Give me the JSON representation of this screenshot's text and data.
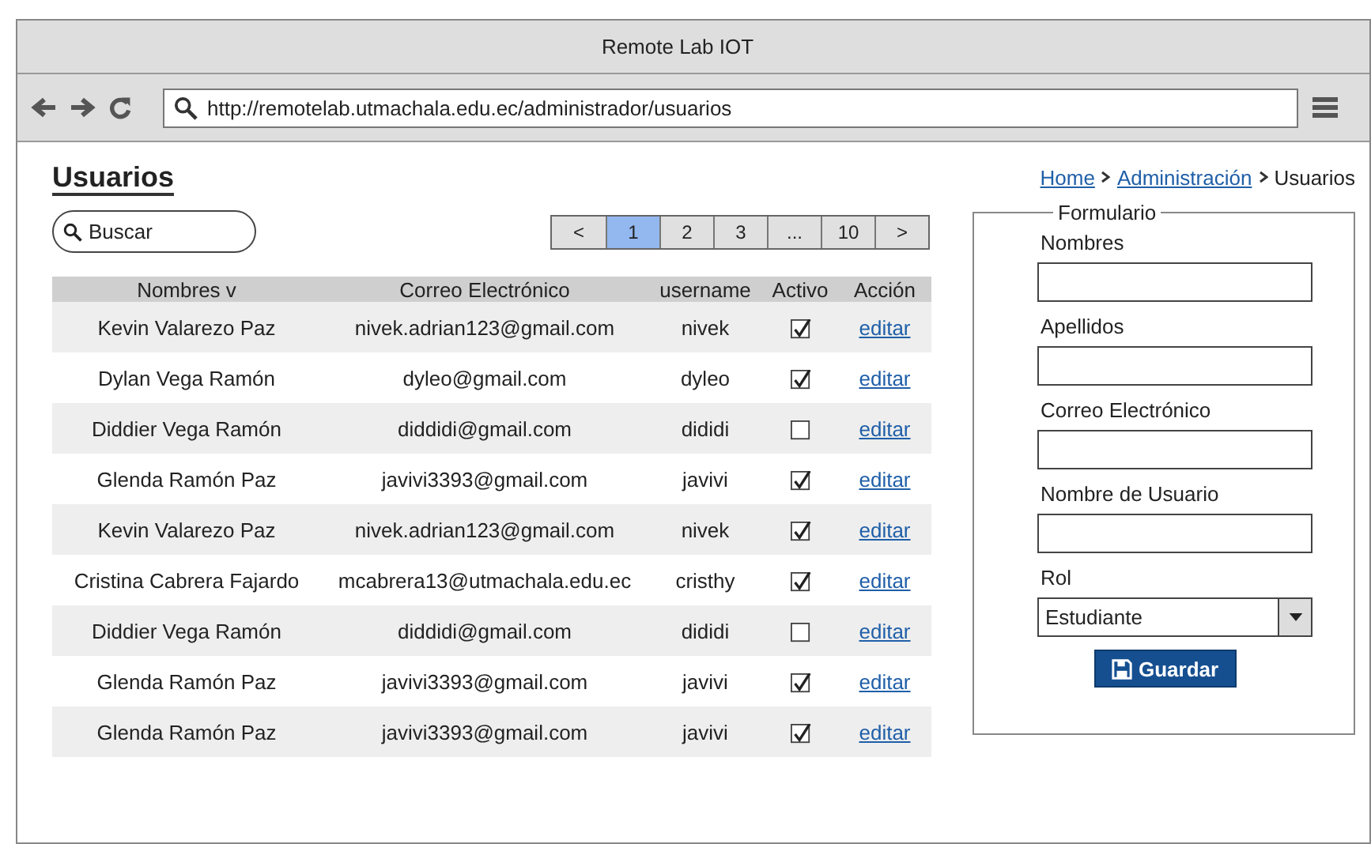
{
  "window": {
    "title": "Remote Lab IOT"
  },
  "browser": {
    "url": "http://remotelab.utmachala.edu.ec/administrador/usuarios"
  },
  "page": {
    "heading": "Usuarios"
  },
  "search": {
    "placeholder": "Buscar"
  },
  "pagination": [
    {
      "label": "<",
      "selected": false
    },
    {
      "label": "1",
      "selected": true
    },
    {
      "label": "2",
      "selected": false
    },
    {
      "label": "3",
      "selected": false
    },
    {
      "label": "...",
      "selected": false
    },
    {
      "label": "10",
      "selected": false
    },
    {
      "label": ">",
      "selected": false
    }
  ],
  "table": {
    "columns": [
      "Nombres v",
      "Correo Electrónico",
      "username",
      "Activo",
      "Acción"
    ],
    "rows": [
      {
        "name": "Kevin Valarezo Paz",
        "email": "nivek.adrian123@gmail.com",
        "username": "nivek",
        "active": true,
        "action": "editar"
      },
      {
        "name": "Dylan Vega Ramón",
        "email": "dyleo@gmail.com",
        "username": "dyleo",
        "active": true,
        "action": "editar"
      },
      {
        "name": "Diddier Vega Ramón",
        "email": "diddidi@gmail.com",
        "username": "dididi",
        "active": false,
        "action": "editar"
      },
      {
        "name": "Glenda Ramón Paz",
        "email": "javivi3393@gmail.com",
        "username": "javivi",
        "active": true,
        "action": "editar"
      },
      {
        "name": "Kevin Valarezo Paz",
        "email": "nivek.adrian123@gmail.com",
        "username": "nivek",
        "active": true,
        "action": "editar"
      },
      {
        "name": "Cristina Cabrera Fajardo",
        "email": "mcabrera13@utmachala.edu.ec",
        "username": "cristhy",
        "active": true,
        "action": "editar"
      },
      {
        "name": "Diddier Vega Ramón",
        "email": "diddidi@gmail.com",
        "username": "dididi",
        "active": false,
        "action": "editar"
      },
      {
        "name": "Glenda Ramón Paz",
        "email": "javivi3393@gmail.com",
        "username": "javivi",
        "active": true,
        "action": "editar"
      },
      {
        "name": "Glenda Ramón Paz",
        "email": "javivi3393@gmail.com",
        "username": "javivi",
        "active": true,
        "action": "editar"
      }
    ]
  },
  "breadcrumb": [
    {
      "label": "Home",
      "kind": "link"
    },
    {
      "label": "Administración",
      "kind": "link"
    },
    {
      "label": "Usuarios",
      "kind": "current"
    }
  ],
  "form": {
    "legend": "Formulario",
    "fields": [
      {
        "label": "Nombres",
        "kind": "text"
      },
      {
        "label": "Apellidos",
        "kind": "text"
      },
      {
        "label": "Correo Electrónico",
        "kind": "text"
      },
      {
        "label": "Nombre de Usuario",
        "kind": "text"
      },
      {
        "label": "Rol",
        "kind": "select",
        "value": "Estudiante"
      }
    ],
    "submit": "Guardar"
  }
}
